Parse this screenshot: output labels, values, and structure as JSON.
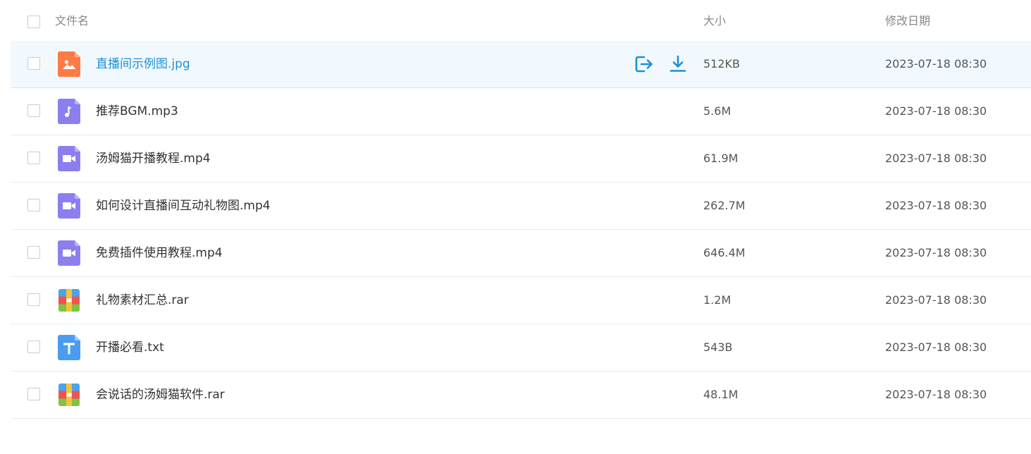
{
  "header": {
    "name_label": "文件名",
    "size_label": "大小",
    "date_label": "修改日期"
  },
  "colors": {
    "accent": "#1a91d6",
    "image_icon": "#ff7a45",
    "audio_icon": "#8b7ff0",
    "video_icon": "#8b7ff0",
    "text_icon": "#4a9cf0"
  },
  "files": [
    {
      "name": "直播间示例图.jpg",
      "size": "512KB",
      "date": "2023-07-18 08:30",
      "icon": "image-icon",
      "hovered": true
    },
    {
      "name": "推荐BGM.mp3",
      "size": "5.6M",
      "date": "2023-07-18 08:30",
      "icon": "audio-icon"
    },
    {
      "name": "汤姆猫开播教程.mp4",
      "size": "61.9M",
      "date": "2023-07-18 08:30",
      "icon": "video-icon"
    },
    {
      "name": "如何设计直播间互动礼物图.mp4",
      "size": "262.7M",
      "date": "2023-07-18 08:30",
      "icon": "video-icon"
    },
    {
      "name": "免费插件使用教程.mp4",
      "size": "646.4M",
      "date": "2023-07-18 08:30",
      "icon": "video-icon"
    },
    {
      "name": "礼物素材汇总.rar",
      "size": "1.2M",
      "date": "2023-07-18 08:30",
      "icon": "archive-icon"
    },
    {
      "name": "开播必看.txt",
      "size": "543B",
      "date": "2023-07-18 08:30",
      "icon": "text-icon"
    },
    {
      "name": "会说话的汤姆猫软件.rar",
      "size": "48.1M",
      "date": "2023-07-18 08:30",
      "icon": "archive-icon"
    }
  ],
  "row_actions": {
    "share_icon": "share-icon",
    "download_icon": "download-icon"
  }
}
